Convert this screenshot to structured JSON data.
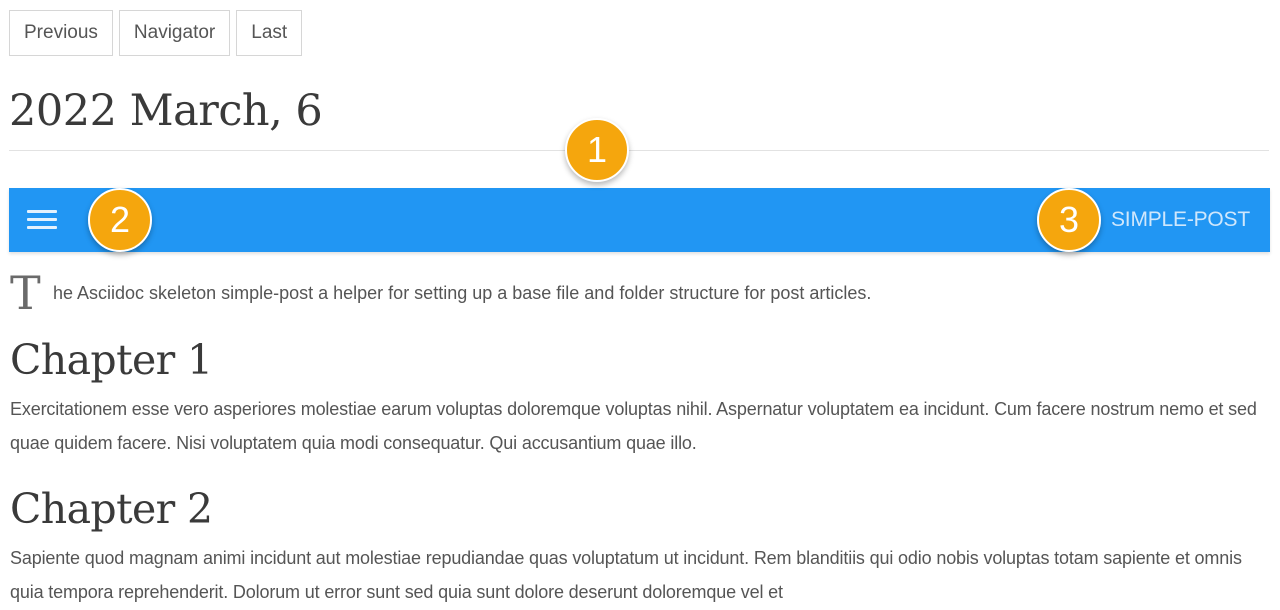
{
  "pager": {
    "previous_label": "Previous",
    "navigator_label": "Navigator",
    "last_label": "Last"
  },
  "page_title": "2022 March, 6",
  "navbar": {
    "menu_icon": "hamburger-menu-icon",
    "brand": "SIMPLE-POST",
    "background_color": "#2196f3"
  },
  "callouts": {
    "one": "1",
    "two": "2",
    "three": "3",
    "color": "#f5a60d"
  },
  "content": {
    "dropcap": "T",
    "lead_rest": "he Asciidoc skeleton simple-post a helper for setting up a base file and folder structure for post articles.",
    "chapter1": {
      "heading": "Chapter 1",
      "text": "Exercitationem esse vero asperiores molestiae earum voluptas doloremque voluptas nihil. Aspernatur voluptatem ea incidunt. Cum facere nostrum nemo et sed quae quidem facere. Nisi voluptatem quia modi consequatur. Qui accusantium quae illo."
    },
    "chapter2": {
      "heading": "Chapter 2",
      "text": "Sapiente quod magnam animi incidunt aut molestiae repudiandae quas voluptatum ut incidunt. Rem blanditiis qui odio nobis voluptas totam sapiente et omnis quia tempora reprehenderit. Dolorum ut error sunt sed quia sunt dolore deserunt doloremque vel et"
    }
  }
}
